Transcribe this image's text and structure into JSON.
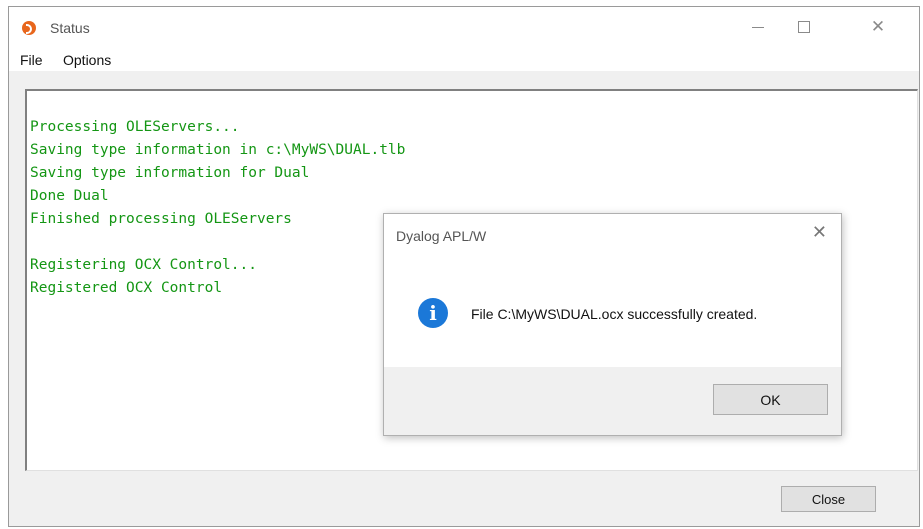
{
  "window": {
    "title": "Status",
    "icon": "dyalog-app-icon",
    "controls": {
      "minimize": "minimize-icon",
      "maximize": "maximize-icon",
      "close": "close-icon"
    }
  },
  "menu": {
    "items": [
      {
        "label": "File"
      },
      {
        "label": "Options"
      }
    ]
  },
  "console": {
    "text_color": "#149614",
    "lines": [
      "Processing OLEServers...",
      "Saving type information in c:\\MyWS\\DUAL.tlb",
      "Saving type information for Dual",
      "Done Dual",
      "Finished processing OLEServers",
      "",
      "Registering OCX Control...",
      "Registered OCX Control"
    ]
  },
  "close_button": {
    "label": "Close"
  },
  "dialog": {
    "title": "Dyalog APL/W",
    "icon": "info-icon",
    "icon_glyph": "i",
    "message": "File C:\\MyWS\\DUAL.ocx successfully created.",
    "ok_label": "OK",
    "close_icon": "close-icon"
  }
}
